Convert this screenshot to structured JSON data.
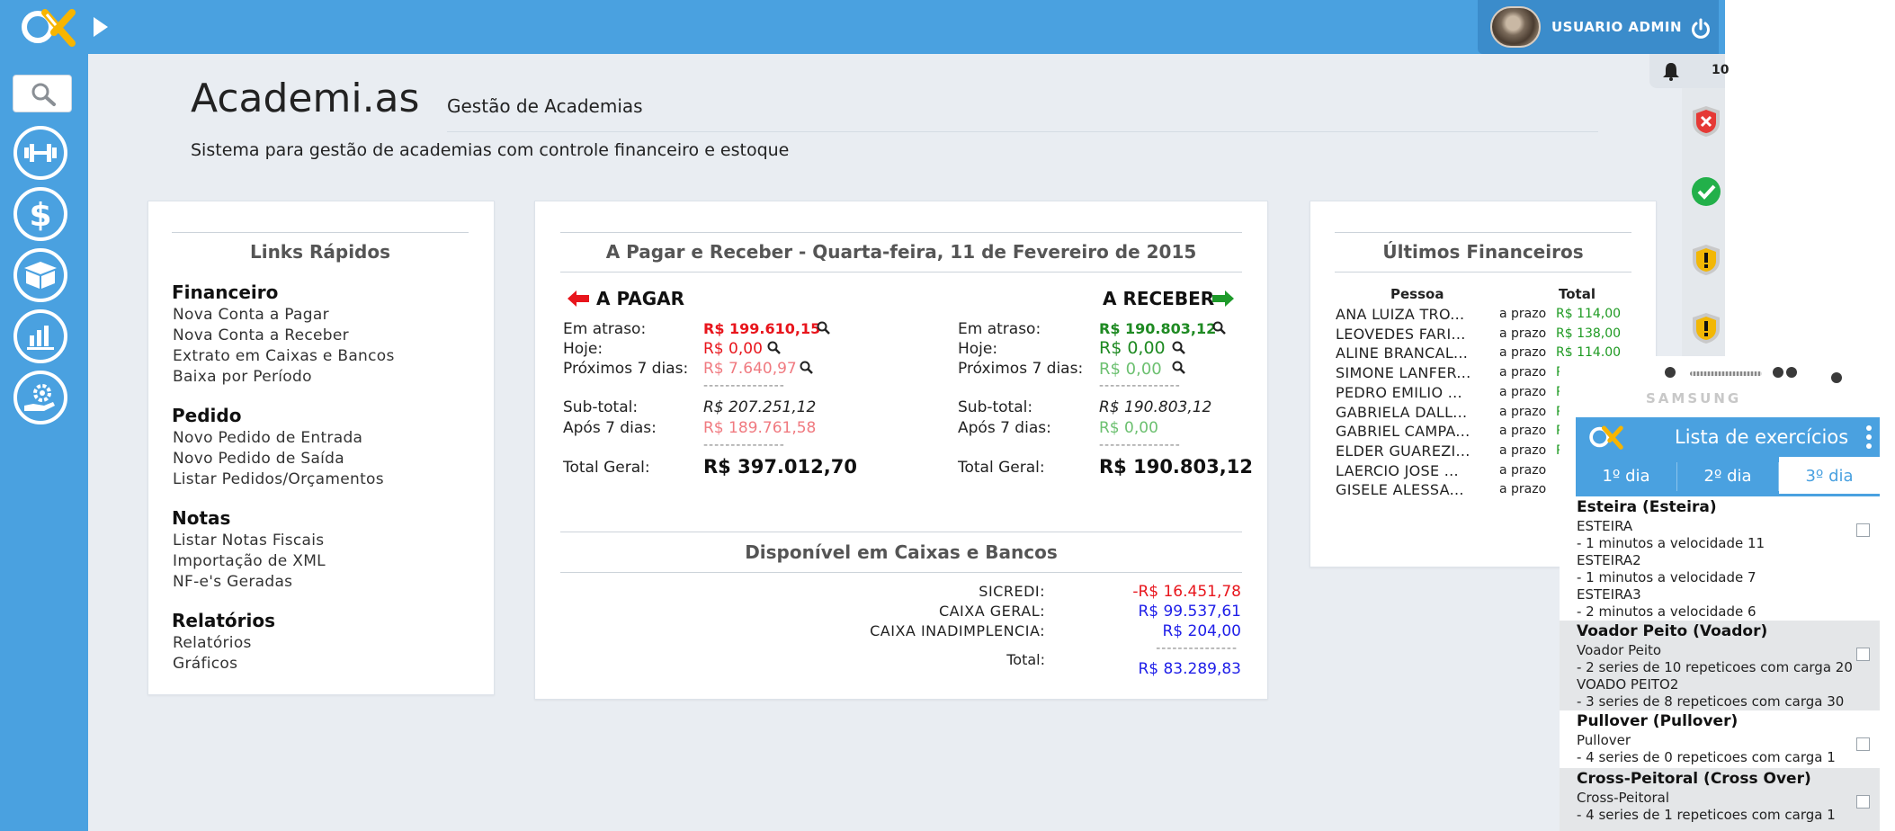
{
  "header": {
    "user_name": "USUARIO ADMIN",
    "notif_count": "10"
  },
  "app": {
    "title": "Academi.as",
    "subtitle": "Gestão de Academias",
    "description": "Sistema para gestão de academias com controle financeiro e estoque"
  },
  "quick_links": {
    "title": "Links Rápidos",
    "sections": [
      {
        "name": "Financeiro",
        "items": [
          "Nova Conta a Pagar",
          "Nova Conta a Receber",
          "Extrato em Caixas e Bancos",
          "Baixa por Período"
        ]
      },
      {
        "name": "Pedido",
        "items": [
          "Novo Pedido de Entrada",
          "Novo Pedido de Saída",
          "Listar Pedidos/Orçamentos"
        ]
      },
      {
        "name": "Notas",
        "items": [
          "Listar Notas Fiscais",
          "Importação de XML",
          "NF-e's Geradas"
        ]
      },
      {
        "name": "Relatórios",
        "items": [
          "Relatórios",
          "Gráficos"
        ]
      }
    ]
  },
  "finance": {
    "title": "A Pagar e Receber - Quarta-feira, 11 de Fevereiro de 2015",
    "pay_label": "A PAGAR",
    "receive_label": "A RECEBER",
    "labels": {
      "overdue": "Em atraso:",
      "today": "Hoje:",
      "next7": "Próximos 7 dias:",
      "subtotal": "Sub-total:",
      "after7": "Após 7 dias:",
      "total": "Total Geral:",
      "dashes": "---------------"
    },
    "pay": {
      "overdue": "R$ 199.610,15",
      "today": "R$ 0,00",
      "next7": "R$ 7.640,97",
      "subtotal": "R$ 207.251,12",
      "after7": "R$ 189.761,58",
      "total": "R$ 397.012,70"
    },
    "receive": {
      "overdue": "R$ 190.803,12",
      "today": "R$ 0,00",
      "next7": "R$ 0,00",
      "subtotal": "R$ 190.803,12",
      "after7": "R$ 0,00",
      "total": "R$ 190.803,12"
    },
    "cash_title": "Disponível em Caixas e Bancos",
    "cash": [
      {
        "name": "SICREDI:",
        "value": "-R$ 16.451,78"
      },
      {
        "name": "CAIXA GERAL:",
        "value": "R$ 99.537,61"
      },
      {
        "name": "CAIXA INADIMPLENCIA:",
        "value": "R$ 204,00"
      }
    ],
    "cash_total_label": "Total:",
    "cash_total_dashes": "---------------",
    "cash_total": "R$ 83.289,83"
  },
  "recent": {
    "title": "Últimos Financeiros",
    "col_person": "Pessoa",
    "col_total": "Total",
    "rows": [
      {
        "name": "ANA LUIZA TRO...",
        "type": "a prazo",
        "total": "R$ 114,00"
      },
      {
        "name": "LEOVEDES FARI...",
        "type": "a prazo",
        "total": "R$ 138,00"
      },
      {
        "name": "ALINE BRANCAL...",
        "type": "a prazo",
        "total": "R$ 114,00"
      },
      {
        "name": "SIMONE LANFER...",
        "type": "a prazo",
        "total": "R$"
      },
      {
        "name": "PEDRO EMILIO ...",
        "type": "a prazo",
        "total": "R"
      },
      {
        "name": "GABRIELA DALL...",
        "type": "a prazo",
        "total": "R"
      },
      {
        "name": "GABRIEL CAMPA...",
        "type": "a prazo",
        "total": "R"
      },
      {
        "name": "ELDER GUAREZI...",
        "type": "a prazo",
        "total": "R"
      },
      {
        "name": "LAERCIO JOSE ...",
        "type": "a prazo",
        "total": ""
      },
      {
        "name": "GISELE ALESSA...",
        "type": "a prazo",
        "total": ""
      }
    ]
  },
  "phone": {
    "brand": "SAMSUNG",
    "app_title": "Lista de exercícios",
    "tabs": [
      "1º dia",
      "2º dia",
      "3º dia"
    ],
    "exercises": [
      {
        "title": "Esteira  (Esteira)",
        "lines": [
          "ESTEIRA",
          " - 1 minutos a velocidade 11",
          "ESTEIRA2",
          " - 1 minutos a velocidade 7",
          "ESTEIRA3",
          " - 2 minutos a velocidade 6"
        ]
      },
      {
        "title": "Voador Peito  (Voador)",
        "lines": [
          "Voador Peito",
          " - 2 series de 10 repeticoes com carga 20",
          "VOADO PEITO2",
          " - 3 series de 8 repeticoes com carga 30"
        ]
      },
      {
        "title": "Pullover  (Pullover)",
        "lines": [
          "Pullover",
          " - 4 series de 0 repeticoes com carga 1"
        ]
      },
      {
        "title": "Cross-Peitoral   (Cross Over)",
        "lines": [
          "Cross-Peitoral",
          " - 4 series de 1 repeticoes com carga 1"
        ]
      }
    ]
  },
  "colors": {
    "brand_blue": "#4aa1e0",
    "pay_red": "#e8151c",
    "receive_green": "#1e8a22",
    "cash_blue": "#1e1ee8"
  }
}
